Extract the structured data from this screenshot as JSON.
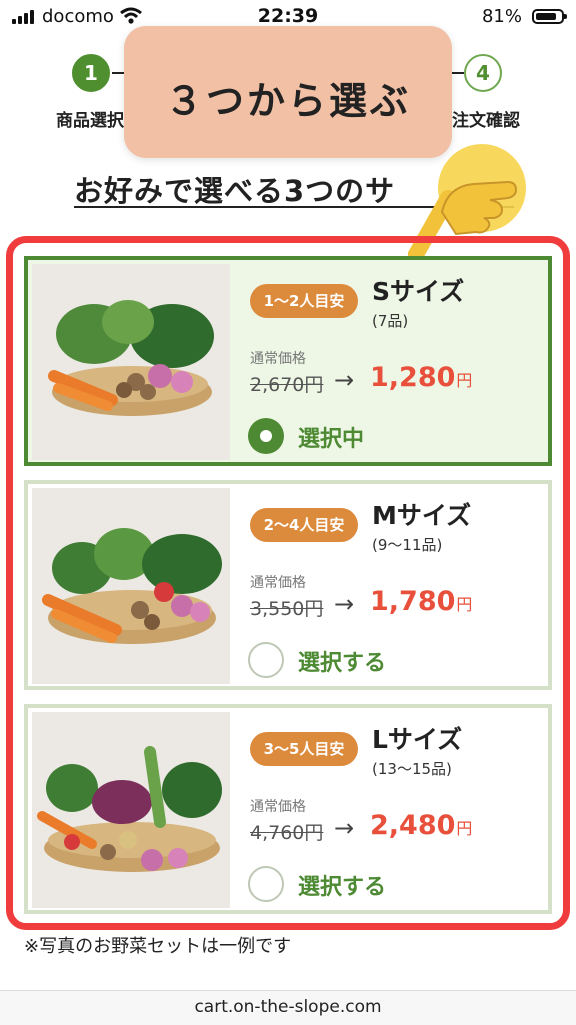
{
  "status_bar": {
    "carrier": "docomo",
    "time": "22:39",
    "battery": "81%"
  },
  "steps": {
    "step1_number": "1",
    "step1_label": "商品選択",
    "step4_number": "4",
    "step4_label": "注文確認"
  },
  "section_title": "お好みで選べる3つのサ",
  "overlay": {
    "text": "３つから選ぶ"
  },
  "price_label": "通常価格",
  "arrow": "→",
  "yen": "円",
  "cards": [
    {
      "badge": "1〜2人目安",
      "size": "Sサイズ",
      "items": "(7品)",
      "old_price": "2,670円",
      "new_price": "1,280",
      "radio_label": "選択中",
      "selected": true
    },
    {
      "badge": "2〜4人目安",
      "size": "Mサイズ",
      "items": "(9〜11品)",
      "old_price": "3,550円",
      "new_price": "1,780",
      "radio_label": "選択する",
      "selected": false
    },
    {
      "badge": "3〜5人目安",
      "size": "Lサイズ",
      "items": "(13〜15品)",
      "old_price": "4,760円",
      "new_price": "2,480",
      "radio_label": "選択する",
      "selected": false
    }
  ],
  "note": "※写真のお野菜セットは一例です",
  "url": "cart.on-the-slope.com",
  "colors": {
    "accent_green": "#4d8a33",
    "price_red": "#e8503c",
    "badge_orange": "#dc8a3c",
    "frame_red": "#f03c3c",
    "overlay_peach": "#f1c0a5"
  }
}
